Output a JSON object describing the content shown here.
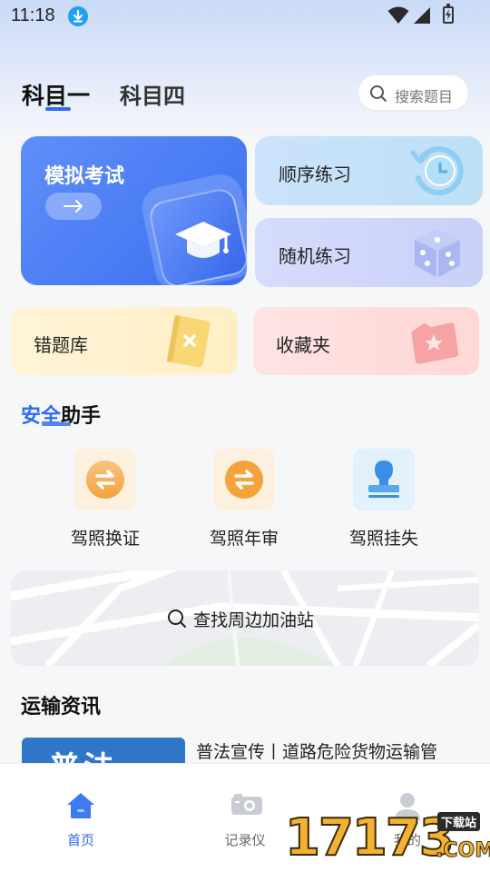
{
  "status_bar": {
    "time": "11:18",
    "icons": [
      "download-icon",
      "wifi-icon",
      "signal-icon",
      "battery-charging-icon"
    ]
  },
  "header": {
    "tabs": [
      {
        "label": "科目一",
        "active": true
      },
      {
        "label": "科目四",
        "active": false
      }
    ],
    "search_placeholder": "搜索题目"
  },
  "cards": {
    "mock_exam": {
      "label": "模拟考试",
      "icon": "graduation-cap-icon"
    },
    "sequential": {
      "label": "顺序练习",
      "icon": "clock-refresh-icon"
    },
    "random": {
      "label": "随机练习",
      "icon": "dice-icon"
    },
    "wrong_questions": {
      "label": "错题库",
      "icon": "wrong-book-icon"
    },
    "favorites": {
      "label": "收藏夹",
      "icon": "star-folder-icon"
    }
  },
  "safety": {
    "title_highlight": "安全",
    "title_rest": "助手",
    "items": [
      {
        "label": "驾照换证",
        "icon": "exchange-icon",
        "color": "#f3a23c"
      },
      {
        "label": "驾照年审",
        "icon": "exchange-icon",
        "color": "#f3a23c"
      },
      {
        "label": "驾照挂失",
        "icon": "stamp-icon",
        "color": "#3b8ee8"
      }
    ]
  },
  "map": {
    "search_label": "查找周边加油站"
  },
  "news": {
    "title": "运输资讯",
    "items": [
      {
        "headline": "普法宣传丨道路危险货物运输管",
        "thumb_text": "普法"
      }
    ]
  },
  "bottom_nav": {
    "items": [
      {
        "label": "首页",
        "icon": "home-icon",
        "active": true
      },
      {
        "label": "记录仪",
        "icon": "camera-icon",
        "active": false
      },
      {
        "label": "我的",
        "icon": "user-icon",
        "active": false
      }
    ]
  },
  "watermark": {
    "digits": "17173",
    "tag": "下载站",
    "suffix": ".COM"
  },
  "colors": {
    "accent": "#2e6bf0",
    "orange": "#f3a23c",
    "blue_icon": "#3b8ee8"
  }
}
